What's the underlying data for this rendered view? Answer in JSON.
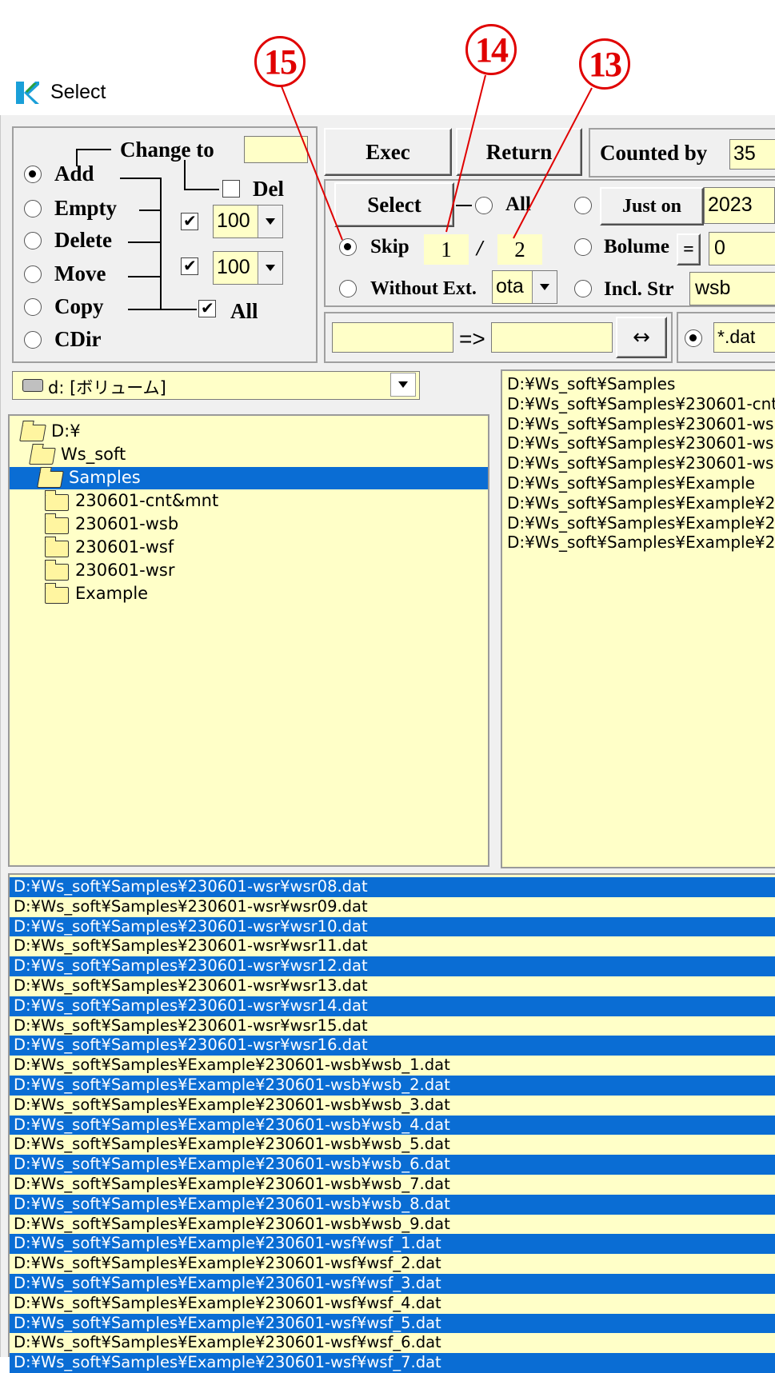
{
  "window": {
    "title": "Select"
  },
  "annotations": [
    "15",
    "14",
    "13"
  ],
  "mode_group": {
    "change_to_label": "Change to",
    "change_to_value": "",
    "del_label": "Del",
    "all_label": "All",
    "options": [
      "Add",
      "Empty",
      "Delete",
      "Move",
      "Copy",
      "CDir"
    ],
    "selected": "Add",
    "check1": true,
    "value1": "100",
    "check2": true,
    "value2": "100",
    "all_checked": true,
    "del_checked": false
  },
  "buttons": {
    "exec": "Exec",
    "return": "Return",
    "select": "Select",
    "just_on": "Just on",
    "swap": "↔",
    "equals": "="
  },
  "counted_by": {
    "label": "Counted by",
    "value": "35"
  },
  "select_opts": {
    "all_label": "All",
    "skip_label": "Skip",
    "skip_num": "1",
    "skip_sep": "/",
    "skip_den": "2",
    "without_ext_label": "Without Ext.",
    "without_ext_value": "ota",
    "year_value": "2023",
    "bolume_label": "Bolume",
    "bolume_value": "0",
    "incl_str_label": "Incl. Str",
    "incl_str_value": "wsb",
    "skip_selected": true
  },
  "rename": {
    "from": "",
    "arrow": "=>",
    "to": "",
    "filter": "*.dat"
  },
  "drive": {
    "value": "d: [ボリューム]"
  },
  "tree": [
    {
      "label": "D:¥",
      "level": 0,
      "open": true,
      "selected": false
    },
    {
      "label": "Ws_soft",
      "level": 1,
      "open": true,
      "selected": false
    },
    {
      "label": "Samples",
      "level": 2,
      "open": true,
      "selected": true
    },
    {
      "label": "230601-cnt&mnt",
      "level": 3,
      "open": false,
      "selected": false
    },
    {
      "label": "230601-wsb",
      "level": 3,
      "open": false,
      "selected": false
    },
    {
      "label": "230601-wsf",
      "level": 3,
      "open": false,
      "selected": false
    },
    {
      "label": "230601-wsr",
      "level": 3,
      "open": false,
      "selected": false
    },
    {
      "label": "Example",
      "level": 3,
      "open": false,
      "selected": false
    }
  ],
  "dir_list": [
    "D:¥Ws_soft¥Samples",
    "D:¥Ws_soft¥Samples¥230601-cnt",
    "D:¥Ws_soft¥Samples¥230601-ws",
    "D:¥Ws_soft¥Samples¥230601-ws",
    "D:¥Ws_soft¥Samples¥230601-ws",
    "D:¥Ws_soft¥Samples¥Example",
    "D:¥Ws_soft¥Samples¥Example¥2",
    "D:¥Ws_soft¥Samples¥Example¥2",
    "D:¥Ws_soft¥Samples¥Example¥2"
  ],
  "file_list": [
    {
      "text": "D:¥Ws_soft¥Samples¥230601-wsr¥wsr08.dat",
      "selected": true
    },
    {
      "text": "D:¥Ws_soft¥Samples¥230601-wsr¥wsr09.dat",
      "selected": false
    },
    {
      "text": "D:¥Ws_soft¥Samples¥230601-wsr¥wsr10.dat",
      "selected": true
    },
    {
      "text": "D:¥Ws_soft¥Samples¥230601-wsr¥wsr11.dat",
      "selected": false
    },
    {
      "text": "D:¥Ws_soft¥Samples¥230601-wsr¥wsr12.dat",
      "selected": true
    },
    {
      "text": "D:¥Ws_soft¥Samples¥230601-wsr¥wsr13.dat",
      "selected": false
    },
    {
      "text": "D:¥Ws_soft¥Samples¥230601-wsr¥wsr14.dat",
      "selected": true
    },
    {
      "text": "D:¥Ws_soft¥Samples¥230601-wsr¥wsr15.dat",
      "selected": false
    },
    {
      "text": "D:¥Ws_soft¥Samples¥230601-wsr¥wsr16.dat",
      "selected": true
    },
    {
      "text": "D:¥Ws_soft¥Samples¥Example¥230601-wsb¥wsb_1.dat",
      "selected": false
    },
    {
      "text": "D:¥Ws_soft¥Samples¥Example¥230601-wsb¥wsb_2.dat",
      "selected": true
    },
    {
      "text": "D:¥Ws_soft¥Samples¥Example¥230601-wsb¥wsb_3.dat",
      "selected": false
    },
    {
      "text": "D:¥Ws_soft¥Samples¥Example¥230601-wsb¥wsb_4.dat",
      "selected": true
    },
    {
      "text": "D:¥Ws_soft¥Samples¥Example¥230601-wsb¥wsb_5.dat",
      "selected": false
    },
    {
      "text": "D:¥Ws_soft¥Samples¥Example¥230601-wsb¥wsb_6.dat",
      "selected": true
    },
    {
      "text": "D:¥Ws_soft¥Samples¥Example¥230601-wsb¥wsb_7.dat",
      "selected": false
    },
    {
      "text": "D:¥Ws_soft¥Samples¥Example¥230601-wsb¥wsb_8.dat",
      "selected": true
    },
    {
      "text": "D:¥Ws_soft¥Samples¥Example¥230601-wsb¥wsb_9.dat",
      "selected": false
    },
    {
      "text": "D:¥Ws_soft¥Samples¥Example¥230601-wsf¥wsf_1.dat",
      "selected": true
    },
    {
      "text": "D:¥Ws_soft¥Samples¥Example¥230601-wsf¥wsf_2.dat",
      "selected": false
    },
    {
      "text": "D:¥Ws_soft¥Samples¥Example¥230601-wsf¥wsf_3.dat",
      "selected": true
    },
    {
      "text": "D:¥Ws_soft¥Samples¥Example¥230601-wsf¥wsf_4.dat",
      "selected": false
    },
    {
      "text": "D:¥Ws_soft¥Samples¥Example¥230601-wsf¥wsf_5.dat",
      "selected": true
    },
    {
      "text": "D:¥Ws_soft¥Samples¥Example¥230601-wsf¥wsf_6.dat",
      "selected": false
    },
    {
      "text": "D:¥Ws_soft¥Samples¥Example¥230601-wsf¥wsf_7.dat",
      "selected": true
    }
  ],
  "colors": {
    "selection": "#0a6dd4",
    "panel_bg": "#ffffc8",
    "annotation": "#e00000",
    "app_icon": "#1a9fd8"
  }
}
